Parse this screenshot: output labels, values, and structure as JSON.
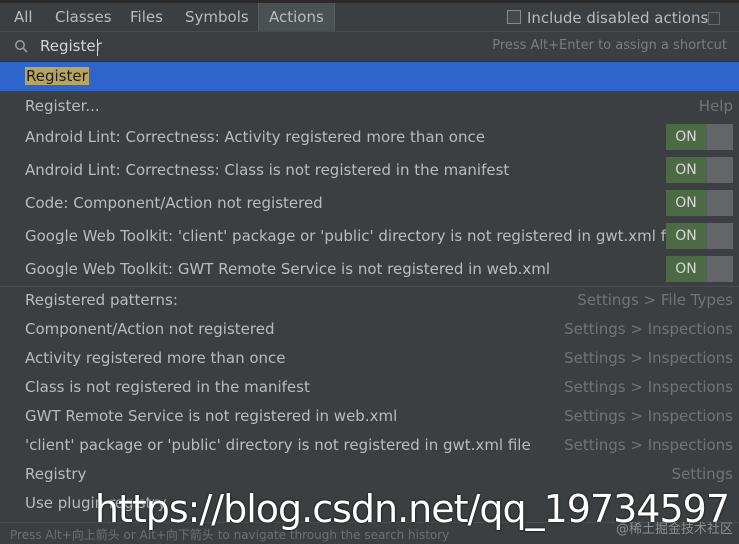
{
  "tabs": [
    {
      "label": "All"
    },
    {
      "label": "Classes"
    },
    {
      "label": "Files"
    },
    {
      "label": "Symbols"
    },
    {
      "label": "Actions"
    }
  ],
  "include_disabled": {
    "label": "Include disabled actions"
  },
  "search": {
    "value": "Register",
    "hint": "Press Alt+Enter to assign a shortcut"
  },
  "rows": [
    {
      "label": "Register"
    },
    {
      "label": "Register...",
      "right": "Help"
    },
    {
      "label": "Android Lint: Correctness: Activity registered more than once",
      "toggle": "ON"
    },
    {
      "label": "Android Lint: Correctness: Class is not registered in the manifest",
      "toggle": "ON"
    },
    {
      "label": "Code: Component/Action not registered",
      "toggle": "ON"
    },
    {
      "label": "Google Web Toolkit: 'client' package or 'public' directory is not registered in gwt.xml file",
      "toggle": "ON"
    },
    {
      "label": "Google Web Toolkit: GWT Remote Service is not registered in web.xml",
      "toggle": "ON"
    },
    {
      "label": "Registered patterns:",
      "right": "Settings > File Types"
    },
    {
      "label": "Component/Action not registered",
      "right": "Settings > Inspections"
    },
    {
      "label": "Activity registered more than once",
      "right": "Settings > Inspections"
    },
    {
      "label": "Class is not registered in the manifest",
      "right": "Settings > Inspections"
    },
    {
      "label": "GWT Remote Service is not registered in web.xml",
      "right": "Settings > Inspections"
    },
    {
      "label": "'client' package or 'public' directory is not registered in gwt.xml file",
      "right": "Settings > Inspections"
    },
    {
      "label": "Registry",
      "right": "Settings"
    },
    {
      "label": "Use plugin registry"
    }
  ],
  "footer": {
    "text": "Press Alt+向上箭头 or Alt+向下箭头 to navigate through the search history"
  },
  "watermark": {
    "url": "https://blog.csdn.net/qq_19734597",
    "brand": "@稀土掘金技术社区"
  },
  "colors": {
    "selection": "#2f65ca",
    "highlight": "#b9a55e",
    "toggle_on": "#4c6a43",
    "background": "#3c3f41"
  }
}
